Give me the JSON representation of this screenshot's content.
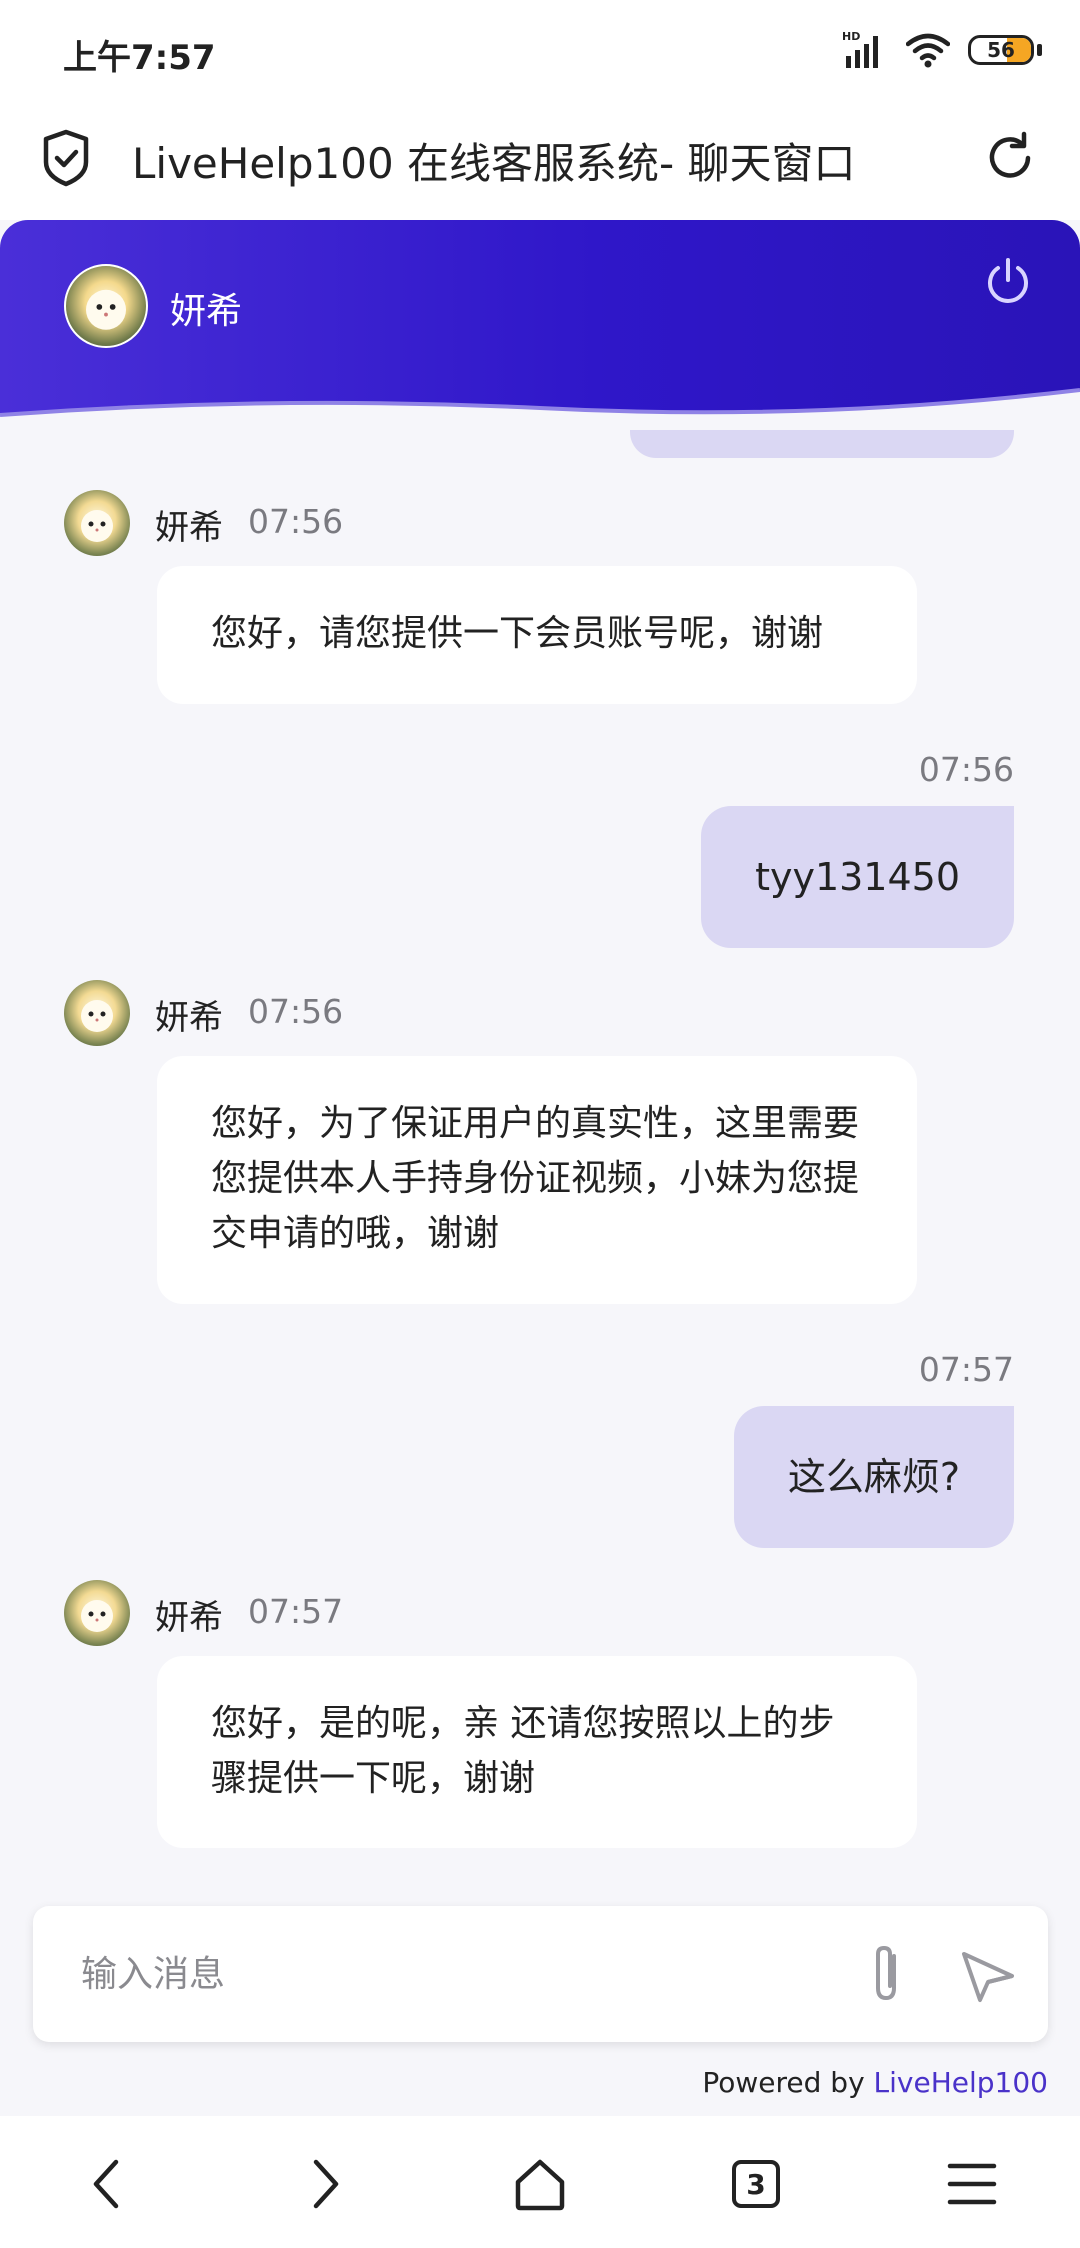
{
  "status_bar": {
    "time": "上午7:57",
    "battery": "56",
    "network_label": "HD"
  },
  "title_bar": {
    "title": "LiveHelp100 在线客服系统- 聊天窗口"
  },
  "chat_header": {
    "agent_name": "妍希"
  },
  "messages": [
    {
      "from": "agent",
      "name": "妍希",
      "time": "07:56",
      "text": "您好，请您提供一下会员账号呢，谢谢"
    },
    {
      "from": "user",
      "time": "07:56",
      "text": "tyy131450"
    },
    {
      "from": "agent",
      "name": "妍希",
      "time": "07:56",
      "text": "您好，为了保证用户的真实性，这里需要您提供本人手持身份证视频，小妹为您提交申请的哦，谢谢"
    },
    {
      "from": "user",
      "time": "07:57",
      "text": "这么麻烦?"
    },
    {
      "from": "agent",
      "name": "妍希",
      "time": "07:57",
      "text": "您好，是的呢，亲 还请您按照以上的步骤提供一下呢，谢谢"
    }
  ],
  "input": {
    "placeholder": "输入消息",
    "value": ""
  },
  "footer": {
    "powered_prefix": "Powered by ",
    "powered_brand": "LiveHelp100"
  },
  "nav": {
    "tab_count": "3"
  },
  "colors": {
    "header_start": "#4a2fd8",
    "header_end": "#2a14b8",
    "user_bubble": "#dad7f3",
    "brand_link": "#4a32c9"
  },
  "icons": [
    "shield-check-icon",
    "reload-icon",
    "power-icon",
    "paperclip-icon",
    "send-icon",
    "back-icon",
    "forward-icon",
    "home-icon",
    "tabs-icon",
    "menu-icon",
    "signal-icon",
    "wifi-icon",
    "battery-icon"
  ]
}
